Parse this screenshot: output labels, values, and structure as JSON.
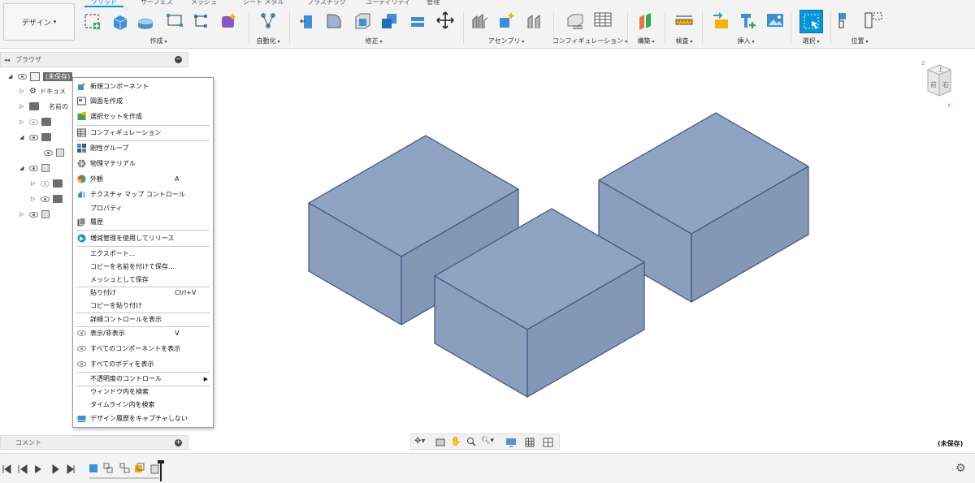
{
  "workspace": {
    "label": "デザイン"
  },
  "tabs": [
    {
      "label": "ソリッド",
      "active": true
    },
    {
      "label": "サーフェス"
    },
    {
      "label": "メッシュ"
    },
    {
      "label": "シート メタル"
    },
    {
      "label": "プラスチック"
    },
    {
      "label": "ユーティリティ"
    },
    {
      "label": "管理"
    }
  ],
  "toolbar_groups": [
    {
      "label": "作成"
    },
    {
      "label": "自動化"
    },
    {
      "label": "修正"
    },
    {
      "label": "アセンブリ"
    },
    {
      "label": "コンフィギュレーション"
    },
    {
      "label": "構築"
    },
    {
      "label": "検査"
    },
    {
      "label": "挿入"
    },
    {
      "label": "選択"
    },
    {
      "label": "位置"
    }
  ],
  "browser": {
    "title": "ブラウザ",
    "root": "(未保存)",
    "items": [
      {
        "label": "ドキュメ"
      },
      {
        "label": "名前の"
      }
    ]
  },
  "context_menu": {
    "items": [
      {
        "label": "新規コンポーネント",
        "icon": "new-component-icon"
      },
      {
        "label": "図面を作成",
        "icon": "drawing-icon"
      },
      {
        "label": "選択セットを作成",
        "icon": "selection-set-icon"
      },
      {
        "label": "コンフィギュレーション",
        "icon": "configuration-icon"
      },
      {
        "label": "剛性グループ",
        "icon": "rigid-group-icon"
      },
      {
        "label": "物理マテリアル",
        "icon": "physical-material-icon"
      },
      {
        "label": "外観",
        "icon": "appearance-icon",
        "shortcut": "A"
      },
      {
        "label": "テクスチャ マップ コントロール",
        "icon": "texture-map-icon"
      },
      {
        "label": "プロパティ"
      },
      {
        "label": "履歴",
        "icon": "history-icon"
      },
      {
        "label": "増減管理を使用してリリース",
        "icon": "release-icon"
      },
      {
        "label": "エクスポート..."
      },
      {
        "label": "コピーを名前を付けて保存..."
      },
      {
        "label": "メッシュとして保存"
      },
      {
        "label": "貼り付け",
        "shortcut": "Ctrl+V"
      },
      {
        "label": "コピーを貼り付け"
      },
      {
        "label": "詳細コントロールを表示"
      },
      {
        "label": "表示/非表示",
        "icon": "eye-icon",
        "shortcut": "V"
      },
      {
        "label": "すべてのコンポーネントを表示",
        "icon": "eye-icon"
      },
      {
        "label": "すべてのボディを表示",
        "icon": "eye-icon"
      },
      {
        "label": "不透明度のコントロール",
        "submenu": true
      },
      {
        "label": "ウィンドウ内を検索"
      },
      {
        "label": "タイムライン内を検索"
      },
      {
        "label": "デザイン履歴をキャプチャしない",
        "icon": "capture-history-icon"
      }
    ]
  },
  "comments": {
    "title": "コメント"
  },
  "status": {
    "unsaved": "(未保存)"
  },
  "viewcube": {
    "top": "上",
    "front": "前",
    "right": "右",
    "z": "Z",
    "x": "X"
  },
  "colors": {
    "accent": "#0696d7",
    "body_face": "#8ea2c0",
    "body_edge": "#3e5285"
  }
}
